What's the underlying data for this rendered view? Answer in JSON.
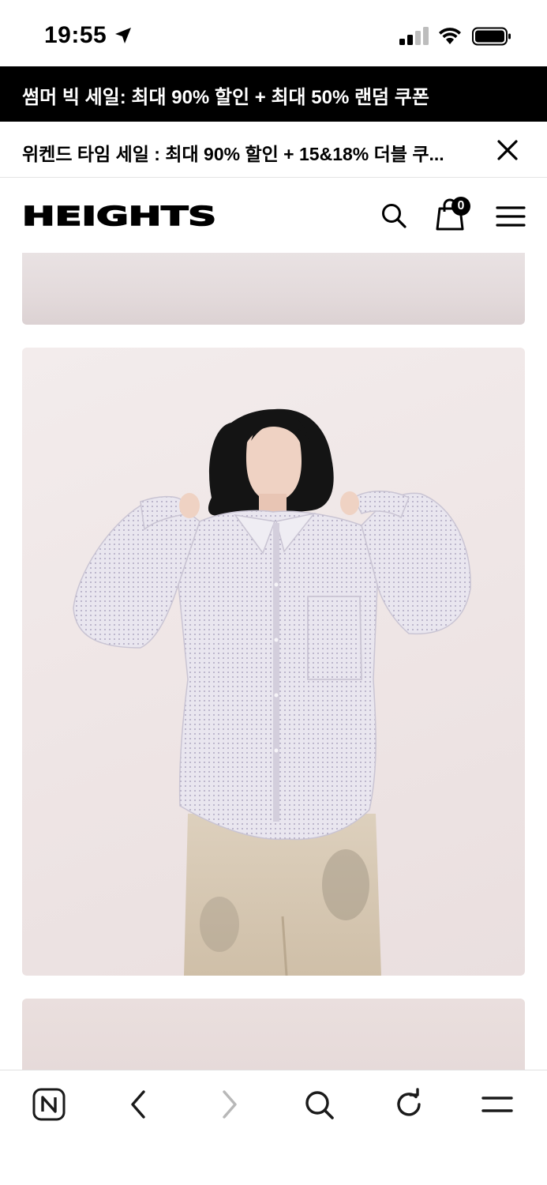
{
  "status_bar": {
    "time": "19:55"
  },
  "promo_banner": {
    "text": "썸머 빅 세일: 최대 90% 할인 + 최대 50% 랜덤 쿠폰"
  },
  "notice_bar": {
    "text": "위켄드 타임 세일 : 최대 90% 할인 + 15&18% 더블 쿠..."
  },
  "header": {
    "logo": "HEIGHTS",
    "cart_count": "0"
  },
  "colors": {
    "banner_bg": "#000000",
    "banner_text": "#ffffff",
    "page_bg": "#ffffff",
    "photo_bg": "#f0e8e8"
  },
  "browser_toolbar": {
    "icons": [
      "naver-icon",
      "back-icon",
      "forward-icon",
      "search-icon",
      "reload-icon",
      "menu-icon"
    ]
  }
}
